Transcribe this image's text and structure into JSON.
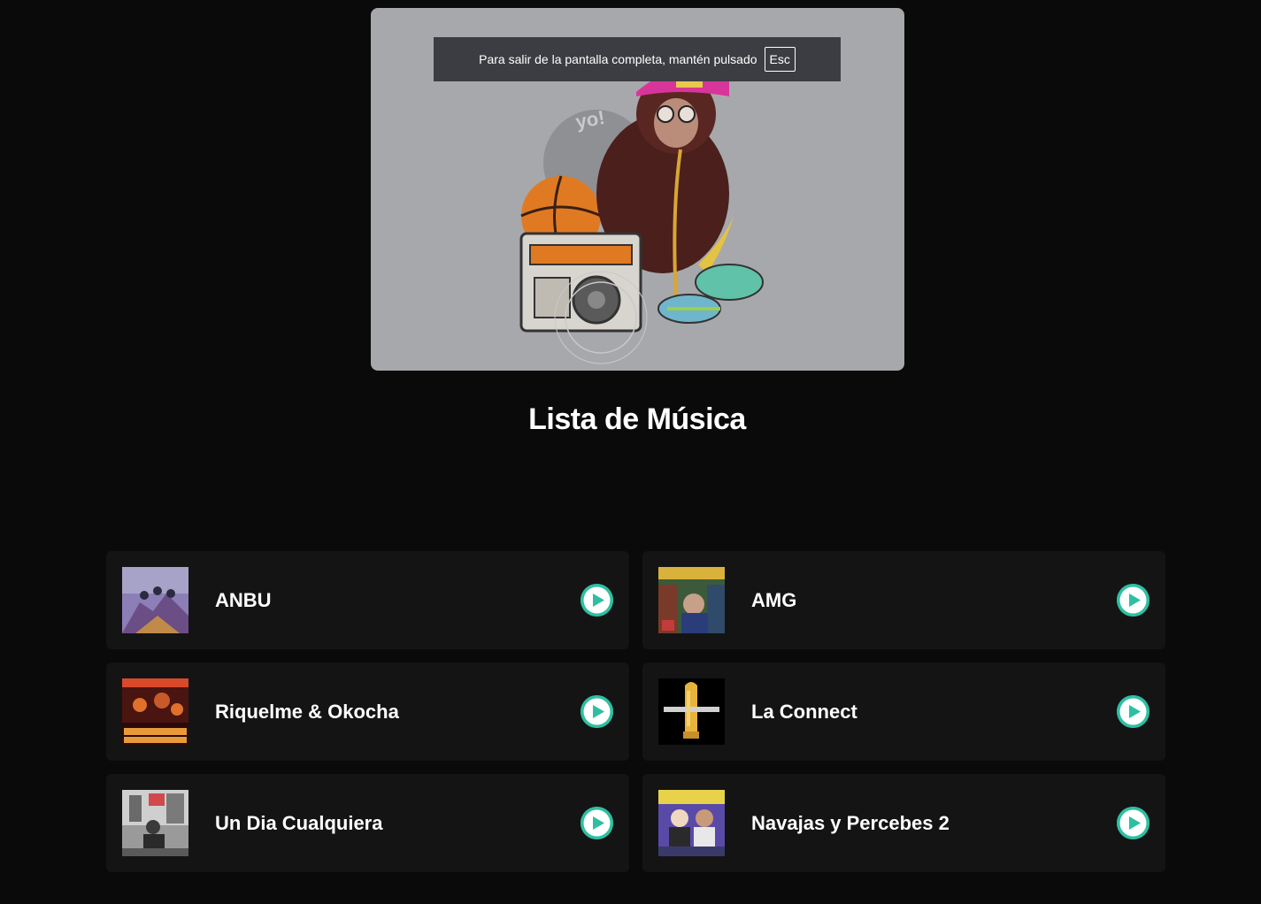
{
  "fullscreen_notice": {
    "text": "Para salir de la pantalla completa, mantén pulsado",
    "key": "Esc"
  },
  "hero": {
    "image": "hip-hop-monkey-illustration"
  },
  "page_title": "Lista de Música",
  "accent_color": "#2ebfa2",
  "songs": [
    {
      "title": "ANBU",
      "cover": "mountain-group-cover"
    },
    {
      "title": "AMG",
      "cover": "street-group-cover"
    },
    {
      "title": "Riquelme & Okocha",
      "cover": "red-concert-cover"
    },
    {
      "title": "La Connect",
      "cover": "golden-bullet-cover"
    },
    {
      "title": "Un Dia Cualquiera",
      "cover": "bw-street-cover"
    },
    {
      "title": "Navajas y Percebes 2",
      "cover": "cartoon-duo-cover"
    }
  ]
}
